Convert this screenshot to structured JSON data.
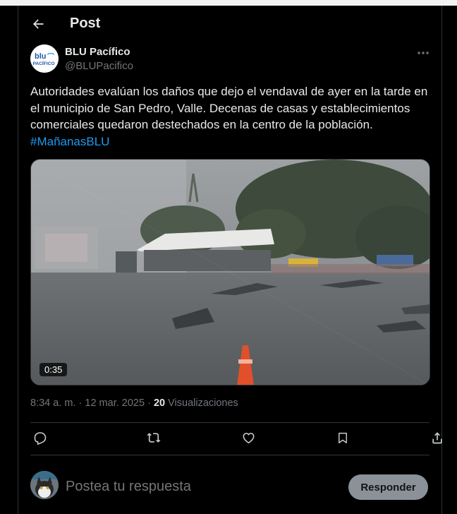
{
  "header": {
    "title": "Post",
    "back_icon": "arrow-left-icon"
  },
  "author": {
    "name": "BLU Pacífico",
    "handle": "@BLUPacifico",
    "avatar_text_top": "blu",
    "avatar_text_bottom": "PACÍFICO",
    "brand_color": "#1f5aa6"
  },
  "tweet": {
    "text": "Autoridades evalúan los daños que dejo el vendaval de ayer en la tarde en el municipio de San Pedro, Valle. Decenas de casas y establecimientos comerciales quedaron destechados en la centro de la población. ",
    "hashtag": "#MañanasBLU",
    "hashtag_color": "#1d9bf0"
  },
  "media": {
    "type": "video",
    "duration": "0:35"
  },
  "meta": {
    "time": "8:34 a. m.",
    "separator": "·",
    "date": "12 mar. 2025",
    "views_count": "20",
    "views_label": "Visualizaciones"
  },
  "actions": [
    "reply-icon",
    "retweet-icon",
    "like-icon",
    "bookmark-icon",
    "share-icon"
  ],
  "reply": {
    "placeholder": "Postea tu respuesta",
    "button_label": "Responder"
  },
  "colors": {
    "background": "#000000",
    "text": "#e7e9ea",
    "muted": "#71767b",
    "border": "#2f3336",
    "button": "#8b9198"
  }
}
